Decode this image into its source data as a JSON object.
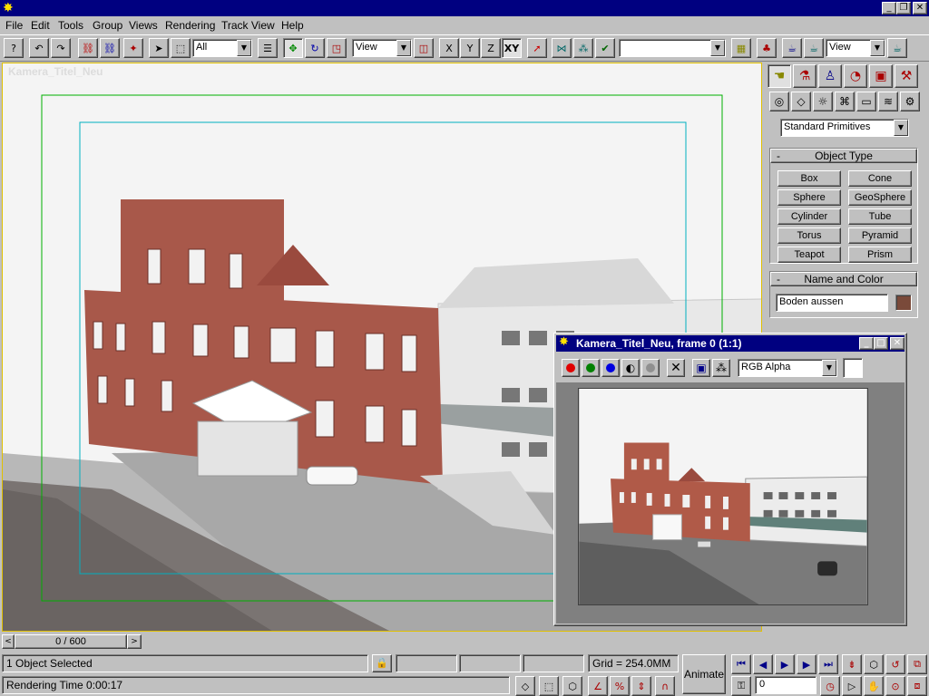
{
  "app": {
    "title": "",
    "logo_icon": "3dsmax-logo-icon",
    "window_buttons": [
      "_",
      "❐",
      "✕"
    ]
  },
  "menu": [
    "File",
    "Edit",
    "Tools",
    "Group",
    "Views",
    "Rendering",
    "Track View",
    "Help"
  ],
  "toolbar": {
    "selection_filter": "All",
    "coord_system": "View",
    "axis_x": "X",
    "axis_y": "Y",
    "axis_z": "Z",
    "axis_xy": "XY",
    "named_selection": "",
    "render_type": "View"
  },
  "viewport": {
    "label": "Kamera_Titel_Neu",
    "frame_counter": "0 / 600"
  },
  "command_panel": {
    "category": "Standard Primitives",
    "object_type_title": "Object Type",
    "primitives": [
      "Box",
      "Cone",
      "Sphere",
      "GeoSphere",
      "Cylinder",
      "Tube",
      "Torus",
      "Pyramid",
      "Teapot",
      "Prism"
    ],
    "name_color_title": "Name and Color",
    "object_name": "Boden aussen",
    "object_color": "#7a4a3a"
  },
  "render_window": {
    "title": "Kamera_Titel_Neu, frame 0 (1:1)",
    "channel": "RGB Alpha",
    "channel_colors": [
      "#e00000",
      "#008000",
      "#0000e0"
    ]
  },
  "status": {
    "selection": "1 Object Selected",
    "render_time": "Rendering Time  0:00:17",
    "grid": "Grid = 254.0MM",
    "animate_label": "Animate",
    "current_frame": "0"
  },
  "colors": {
    "titlebar": "#000080",
    "safe_frame_outer": "#00b000",
    "safe_frame_inner": "#00b0c0",
    "viewport_border": "#e0c000"
  }
}
